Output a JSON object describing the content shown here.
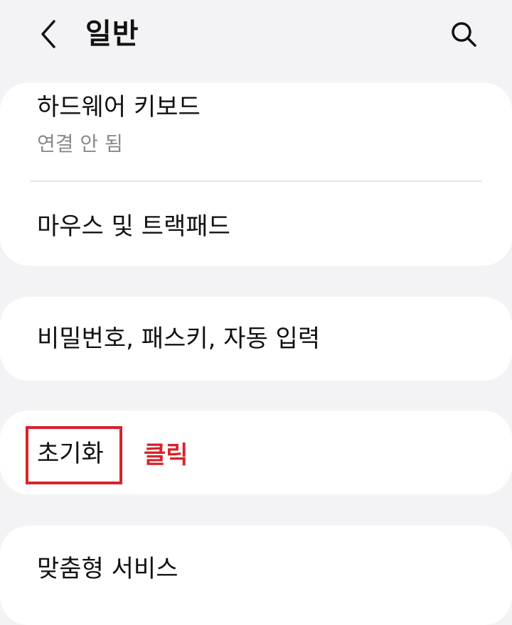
{
  "header": {
    "back_icon": "chevron-left-icon",
    "title": "일반",
    "search_icon": "search-icon"
  },
  "settings": {
    "hardware_keyboard": {
      "title": "하드웨어 키보드",
      "subtitle": "연결 안 됨"
    },
    "mouse_trackpad": {
      "title": "마우스 및 트랙패드"
    },
    "passwords_autofill": {
      "title": "비밀번호, 패스키, 자동 입력"
    },
    "reset": {
      "title": "초기화"
    },
    "customization_service": {
      "title": "맞춤형 서비스"
    }
  },
  "annotation": {
    "label": "클릭",
    "color": "#d8232a"
  },
  "colors": {
    "background": "#f3f3f5",
    "card": "#ffffff",
    "secondary_text": "#8a8a8a"
  }
}
